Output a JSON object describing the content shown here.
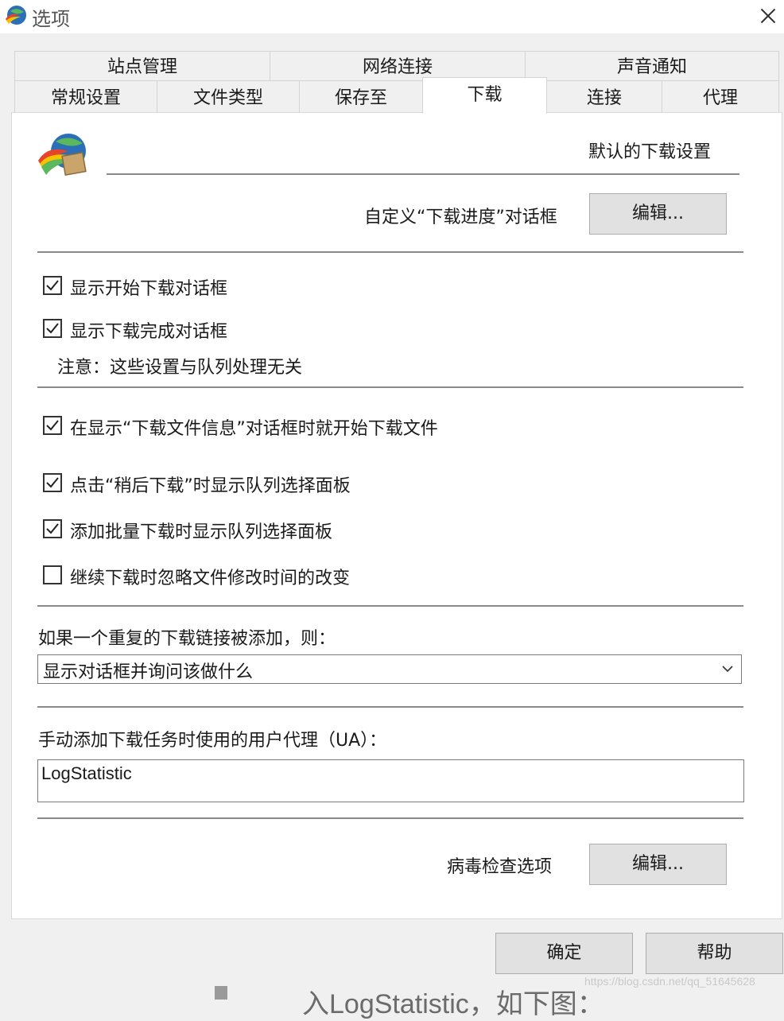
{
  "window": {
    "title": "选项",
    "accent": "#2a6fb8"
  },
  "tabs_row1": [
    {
      "label": "站点管理"
    },
    {
      "label": "网络连接"
    },
    {
      "label": "声音通知"
    }
  ],
  "tabs_row2": [
    {
      "label": "常规设置"
    },
    {
      "label": "文件类型"
    },
    {
      "label": "保存至"
    },
    {
      "label": "下载",
      "active": true
    },
    {
      "label": "连接"
    },
    {
      "label": "代理"
    }
  ],
  "header": {
    "title": "默认的下载设置"
  },
  "progress_dialog": {
    "label": "自定义“下载进度”对话框",
    "edit_button": "编辑..."
  },
  "checkboxes": [
    {
      "label": "显示开始下载对话框",
      "checked": true
    },
    {
      "label": "显示下载完成对话框",
      "checked": true
    },
    {
      "label": "在显示“下载文件信息”对话框时就开始下载文件",
      "checked": true
    },
    {
      "label": "点击“稍后下载”时显示队列选择面板",
      "checked": true
    },
    {
      "label": "添加批量下载时显示队列选择面板",
      "checked": true
    },
    {
      "label": "继续下载时忽略文件修改时间的改变",
      "checked": false
    }
  ],
  "note": "注意：这些设置与队列处理无关",
  "duplicate": {
    "label": "如果一个重复的下载链接被添加，则：",
    "selected": "显示对话框并询问该做什么"
  },
  "user_agent": {
    "label": "手动添加下载任务时使用的用户代理（UA）：",
    "value": "LogStatistic"
  },
  "virus": {
    "label": "病毒检查选项",
    "edit_button": "编辑..."
  },
  "footer": {
    "ok": "确定",
    "help": "帮助"
  },
  "background": {
    "text": "入LogStatistic，如下图：",
    "watermark": "https://blog.csdn.net/qq_51645628"
  }
}
